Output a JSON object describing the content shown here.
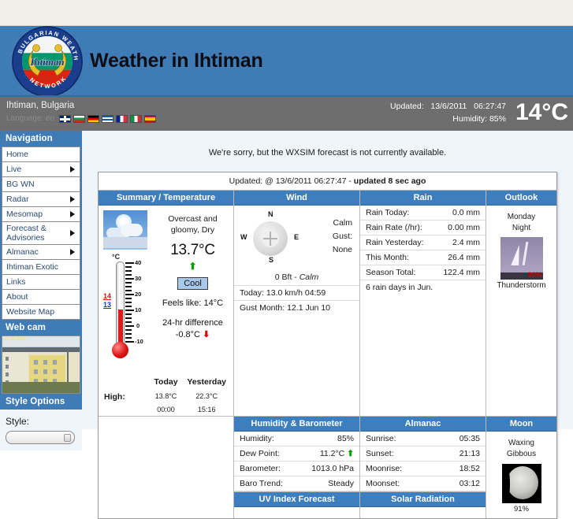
{
  "site": {
    "title": "Weather in Ihtiman",
    "logo_text_top": "BULGARIAN WEATHER",
    "logo_text_bottom": "NETWORK",
    "logo_center": "Ihtiman"
  },
  "statusbar": {
    "location": "Ihtiman, Bulgaria",
    "language_label": "Language: en",
    "flags": [
      {
        "name": "flag-uk",
        "class": "f-uk"
      },
      {
        "name": "flag-bulgaria",
        "class": "f-bg"
      },
      {
        "name": "flag-germany",
        "class": "f-de"
      },
      {
        "name": "flag-greece",
        "class": "f-gr"
      },
      {
        "name": "flag-france",
        "class": "f-fr"
      },
      {
        "name": "flag-italy",
        "class": "f-it"
      },
      {
        "name": "flag-spain",
        "class": "f-es"
      }
    ],
    "updated_label": "Updated:",
    "updated_date": "13/6/2011",
    "updated_time": "06:27:47",
    "humidity_line": "Humidity: 85%",
    "big_temperature": "14°C"
  },
  "sidebar": {
    "nav_heading": "Navigation",
    "items": [
      {
        "label": "Home",
        "arrow": false
      },
      {
        "label": "Live",
        "arrow": true
      },
      {
        "label": "BG WN",
        "arrow": false
      },
      {
        "label": "Radar",
        "arrow": true
      },
      {
        "label": "Mesomap",
        "arrow": true
      },
      {
        "label": "Forecast & Advisories",
        "arrow": true
      },
      {
        "label": "Almanac",
        "arrow": true
      },
      {
        "label": "Ihtiman Exotic",
        "arrow": false
      },
      {
        "label": "Links",
        "arrow": false
      },
      {
        "label": "About",
        "arrow": false
      },
      {
        "label": "Website Map",
        "arrow": false
      }
    ],
    "webcam_heading": "Web cam",
    "webcam_timestamp": "13.06.2011",
    "style_heading": "Style Options",
    "style_label": "Style:",
    "style_value": ""
  },
  "main": {
    "notice": "We're sorry, but the WXSIM forecast is not currently available.",
    "updated_prefix": "Updated: @ 13/6/2011 06:27:47 - ",
    "updated_bold": "updated 8 sec ago"
  },
  "summary": {
    "heading": "Summary / Temperature",
    "condition": "Overcast and gloomy, Dry",
    "temperature": "13.7°C",
    "trend_arrow": "⬆",
    "badge": "Cool",
    "feels_like": "Feels like: 14°C",
    "diff_title": "24-hr difference",
    "diff_value": "-0.8°C",
    "diff_arrow": "⬇",
    "thermo_unit": "°C",
    "thermo_high_mark": "14",
    "thermo_low_mark": "13",
    "thermo_labels": [
      "40",
      "30",
      "20",
      "10",
      "0",
      "-10"
    ],
    "col_today": "Today",
    "col_yesterday": "Yesterday",
    "high_label": "High:",
    "high_today": "13.8°C",
    "high_yesterday": "22.3°C",
    "high_today_time": "00:00",
    "high_yesterday_time": "15:16"
  },
  "wind": {
    "heading": "Wind",
    "dir_n": "N",
    "dir_s": "S",
    "dir_w": "W",
    "dir_e": "E",
    "speed": "Calm",
    "gust_label": "Gust:",
    "gust_value": "None",
    "beaufort": "0 Bft - ",
    "beaufort_desc": "Calm",
    "today": "Today: 13.0 km/h 04:59",
    "gust_month": "Gust Month: 12.1 Jun 10"
  },
  "rain": {
    "heading": "Rain",
    "rows": [
      {
        "k": "Rain Today:",
        "v": "0.0 mm"
      },
      {
        "k": "Rain Rate (/hr):",
        "v": "0.00 mm"
      },
      {
        "k": "Rain Yesterday:",
        "v": "2.4 mm"
      },
      {
        "k": "This Month:",
        "v": "26.4 mm"
      },
      {
        "k": "Season Total:",
        "v": "122.4 mm"
      }
    ],
    "footer": "6 rain days in Jun."
  },
  "outlook": {
    "heading": "Outlook",
    "when_line1": "Monday",
    "when_line2": "Night",
    "probability": "30%",
    "caption": "Thunderstorm"
  },
  "humidity": {
    "heading": "Humidity & Barometer",
    "rows": [
      {
        "k": "Humidity:",
        "v": "85%",
        "arrow": ""
      },
      {
        "k": "Dew Point:",
        "v": "11.2°C",
        "arrow": "⬆"
      },
      {
        "k": "Barometer:",
        "v": "1013.0 hPa",
        "arrow": ""
      },
      {
        "k": "Baro Trend:",
        "v": "Steady",
        "arrow": ""
      }
    ],
    "uv_heading": "UV Index Forecast"
  },
  "almanac": {
    "heading": "Almanac",
    "rows": [
      {
        "k": "Sunrise:",
        "v": "05:35"
      },
      {
        "k": "Sunset:",
        "v": "21:13"
      },
      {
        "k": "Moonrise:",
        "v": "18:52"
      },
      {
        "k": "Moonset:",
        "v": "03:12"
      }
    ],
    "solar_heading": "Solar Radiation"
  },
  "moon": {
    "heading": "Moon",
    "phase_line1": "Waxing",
    "phase_line2": "Gibbous",
    "illumination": "91%"
  },
  "colors": {
    "brand_blue": "#3f7bb5",
    "panel_header": "#3d7ebf",
    "status_grey": "#6e6e6e",
    "content_bg": "#eef5fb",
    "up_green": "#00a000",
    "down_red": "#e00000"
  }
}
